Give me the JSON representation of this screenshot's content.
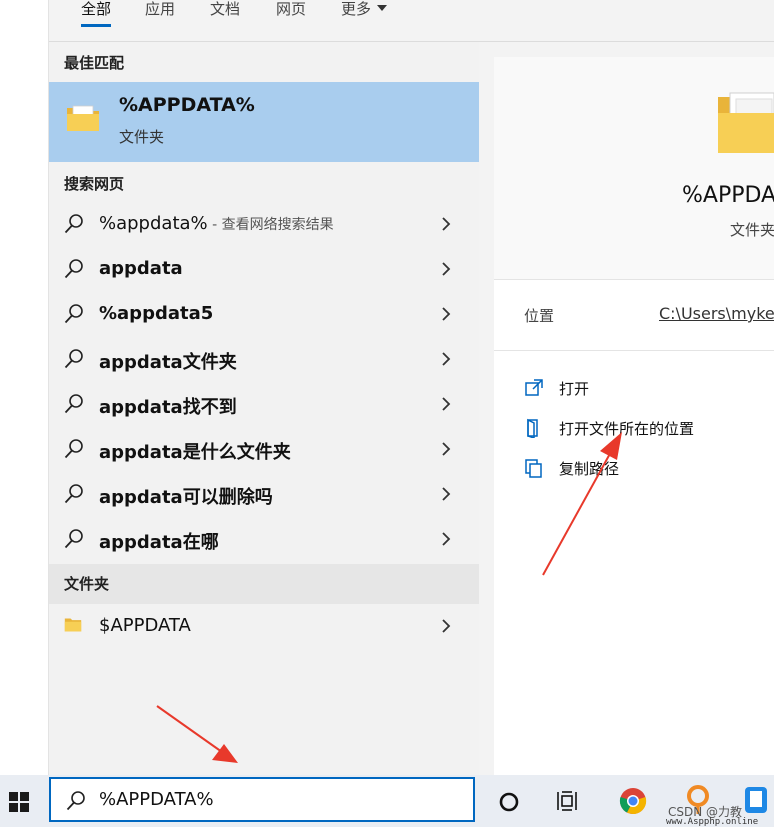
{
  "tabs": [
    {
      "label": "全部",
      "active": true
    },
    {
      "label": "应用"
    },
    {
      "label": "文档"
    },
    {
      "label": "网页"
    },
    {
      "label": "更多"
    }
  ],
  "sections": {
    "best_match": "最佳匹配",
    "web": "搜索网页",
    "folders": "文件夹"
  },
  "best_match": {
    "title": "%APPDATA%",
    "subtitle": "文件夹",
    "icon": "folder-icon"
  },
  "web_results": [
    {
      "text": "%appdata%",
      "hint": " - 查看网络搜索结果"
    },
    {
      "text": "appdata"
    },
    {
      "text": "%appdata5"
    },
    {
      "text": "appdata文件夹"
    },
    {
      "text": "appdata找不到"
    },
    {
      "text": "appdata是什么文件夹"
    },
    {
      "text": "appdata可以删除吗"
    },
    {
      "text": "appdata在哪"
    }
  ],
  "folder_results": [
    {
      "text": "$APPDATA",
      "icon": "folder-icon"
    }
  ],
  "detail": {
    "title": "%APPDA",
    "type": "文件夹",
    "location_label": "位置",
    "location_path": "C:\\Users\\myke",
    "actions": [
      {
        "label": "打开",
        "icon": "open-external-icon"
      },
      {
        "label": "打开文件所在的位置",
        "icon": "open-location-icon"
      },
      {
        "label": "复制路径",
        "icon": "copy-icon"
      }
    ]
  },
  "search": {
    "value": "%APPDATA%"
  },
  "watermark": {
    "csdn": "CSDN @力教",
    "site": "www.Aspphp.online"
  },
  "colors": {
    "accent": "#0067c0",
    "selected": "#a9cdee",
    "annotation_arrow": "#e8392b",
    "folder": "#f5c542"
  }
}
